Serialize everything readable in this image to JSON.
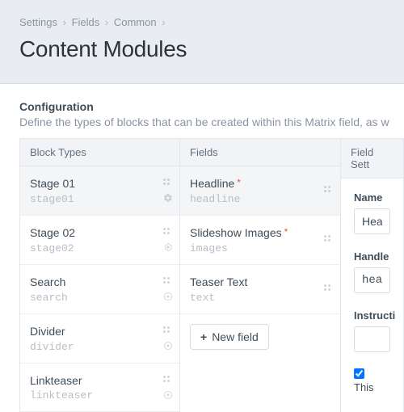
{
  "breadcrumb": [
    "Settings",
    "Fields",
    "Common"
  ],
  "page_title": "Content Modules",
  "config": {
    "heading": "Configuration",
    "desc": "Define the types of blocks that can be created within this Matrix field, as w"
  },
  "columns": {
    "block_types_head": "Block Types",
    "fields_head": "Fields",
    "settings_head": "Field Sett"
  },
  "block_types": [
    {
      "label": "Stage 01",
      "handle": "stage01",
      "selected": true
    },
    {
      "label": "Stage 02",
      "handle": "stage02",
      "selected": false
    },
    {
      "label": "Search",
      "handle": "search",
      "selected": false
    },
    {
      "label": "Divider",
      "handle": "divider",
      "selected": false
    },
    {
      "label": "Linkteaser",
      "handle": "linkteaser",
      "selected": false
    }
  ],
  "fields": [
    {
      "label": "Headline",
      "handle": "headline",
      "required": true,
      "selected": true
    },
    {
      "label": "Slideshow Images",
      "handle": "images",
      "required": true,
      "selected": false
    },
    {
      "label": "Teaser Text",
      "handle": "text",
      "required": false,
      "selected": false
    }
  ],
  "new_field_label": "New field",
  "settings": {
    "name_label": "Name",
    "name_value": "Headli",
    "handle_label": "Handle",
    "handle_value": "headli",
    "instructions_label": "Instructi",
    "required_checkbox_label": "This"
  }
}
